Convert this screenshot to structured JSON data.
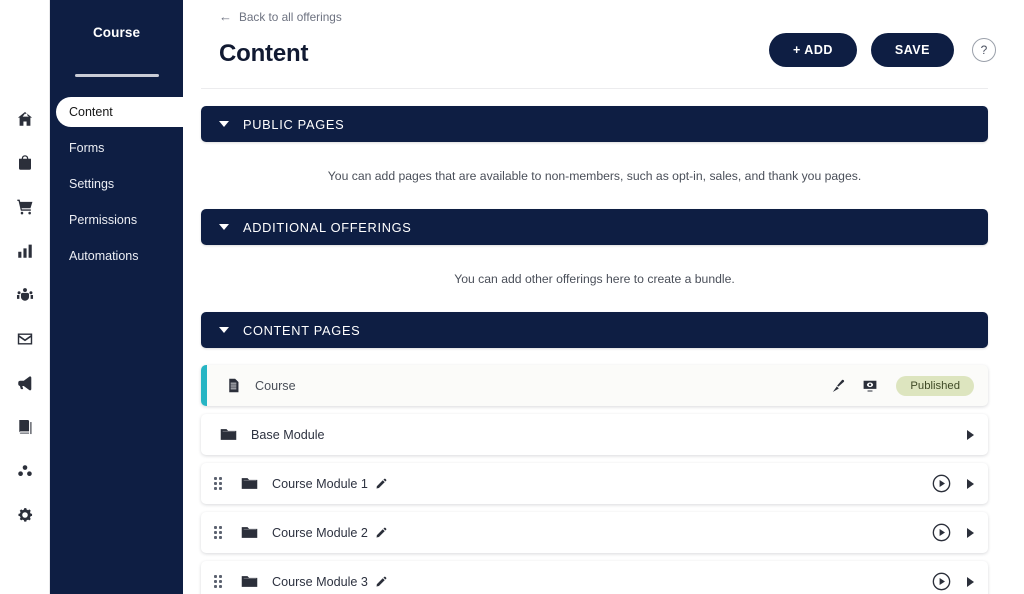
{
  "colors": {
    "navy": "#0e1e43",
    "teal_accent": "#27b5c4",
    "badge_bg": "#dde5bf",
    "badge_text": "#3f4a26",
    "page_bg": "#ffffff"
  },
  "icon_rail": {
    "items": [
      {
        "name": "home-icon",
        "label": "Home"
      },
      {
        "name": "bag-icon",
        "label": "Products"
      },
      {
        "name": "cart-icon",
        "label": "Orders"
      },
      {
        "name": "bar-chart-icon",
        "label": "Analytics"
      },
      {
        "name": "people-icon",
        "label": "Members"
      },
      {
        "name": "envelope-icon",
        "label": "Email"
      },
      {
        "name": "megaphone-icon",
        "label": "Marketing"
      },
      {
        "name": "book-icon",
        "label": "Library"
      },
      {
        "name": "community-icon",
        "label": "Community"
      },
      {
        "name": "gear-icon",
        "label": "Settings"
      }
    ]
  },
  "sidebar": {
    "title": "Course",
    "items": [
      {
        "label": "Content",
        "active": true
      },
      {
        "label": "Forms",
        "active": false
      },
      {
        "label": "Settings",
        "active": false
      },
      {
        "label": "Permissions",
        "active": false
      },
      {
        "label": "Automations",
        "active": false
      }
    ]
  },
  "header": {
    "back_label": "Back to all offerings",
    "back_arrow": "←",
    "title": "Content",
    "add_label": "+ ADD",
    "save_label": "SAVE",
    "help_label": "?"
  },
  "sections": [
    {
      "key": "public_pages",
      "title": "PUBLIC PAGES",
      "note": "You can add pages that are available to non-members, such as opt-in, sales, and thank you pages."
    },
    {
      "key": "additional_offerings",
      "title": "ADDITIONAL OFFERINGS",
      "note": "You can add other offerings here to create a bundle."
    },
    {
      "key": "content_pages",
      "title": "CONTENT PAGES",
      "note": ""
    }
  ],
  "content_rows": [
    {
      "label": "Course",
      "icon": "document-icon",
      "accented": true,
      "draggable": false,
      "editable": false,
      "has_brush": true,
      "has_preview": true,
      "has_play": false,
      "has_chevron": false,
      "badge": "Published"
    },
    {
      "label": "Base Module",
      "icon": "folder-icon",
      "accented": false,
      "draggable": false,
      "editable": false,
      "has_brush": false,
      "has_preview": false,
      "has_play": false,
      "has_chevron": true,
      "badge": ""
    },
    {
      "label": "Course Module 1",
      "icon": "folder-icon",
      "accented": false,
      "draggable": true,
      "editable": true,
      "has_brush": false,
      "has_preview": false,
      "has_play": true,
      "has_chevron": true,
      "badge": ""
    },
    {
      "label": "Course Module 2",
      "icon": "folder-icon",
      "accented": false,
      "draggable": true,
      "editable": true,
      "has_brush": false,
      "has_preview": false,
      "has_play": true,
      "has_chevron": true,
      "badge": ""
    },
    {
      "label": "Course Module 3",
      "icon": "folder-icon",
      "accented": false,
      "draggable": true,
      "editable": true,
      "has_brush": false,
      "has_preview": false,
      "has_play": true,
      "has_chevron": true,
      "badge": ""
    }
  ]
}
